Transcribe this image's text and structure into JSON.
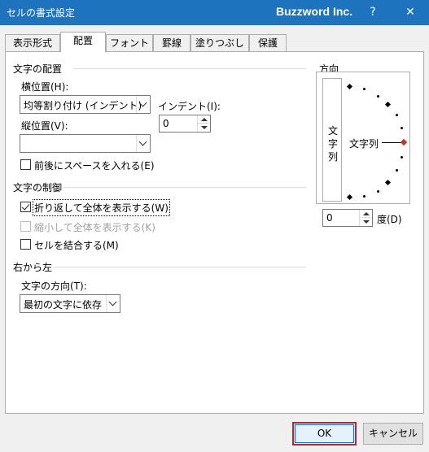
{
  "window": {
    "title": "セルの書式設定",
    "brand": "Buzzword Inc.",
    "help_label": "?",
    "close_label": "✕",
    "title_bar_color": "#1e73be",
    "accent_red": "#c8202b"
  },
  "tabs": [
    {
      "label": "表示形式",
      "active": false
    },
    {
      "label": "配置",
      "active": true
    },
    {
      "label": "フォント",
      "active": false
    },
    {
      "label": "罫線",
      "active": false
    },
    {
      "label": "塗りつぶし",
      "active": false
    },
    {
      "label": "保護",
      "active": false
    }
  ],
  "alignment": {
    "section_title": "文字の配置",
    "horizontal_label": "横位置(H):",
    "horizontal_value": "均等割り付け (インデント)",
    "vertical_label": "縦位置(V):",
    "vertical_value": "",
    "indent_label": "インデント(I):",
    "indent_value": "0",
    "space_label": "前後にスペースを入れる(E)"
  },
  "text_control": {
    "section_title": "文字の制御",
    "wrap_label": "折り返して全体を表示する(W)",
    "wrap_checked": true,
    "shrink_label": "縮小して全体を表示する(K)",
    "shrink_enabled": false,
    "merge_label": "セルを結合する(M)",
    "merge_checked": false
  },
  "rtl": {
    "section_title": "右から左",
    "direction_label": "文字の方向(T):",
    "direction_value": "最初の文字に依存"
  },
  "orientation": {
    "section_title": "方向",
    "vertical_text": "文字列",
    "dial_text": "文字列",
    "degree_value": "0",
    "degree_label": "度(D)",
    "needle_color": "#c0392b"
  },
  "footer": {
    "ok_label": "OK",
    "cancel_label": "キャンセル"
  }
}
